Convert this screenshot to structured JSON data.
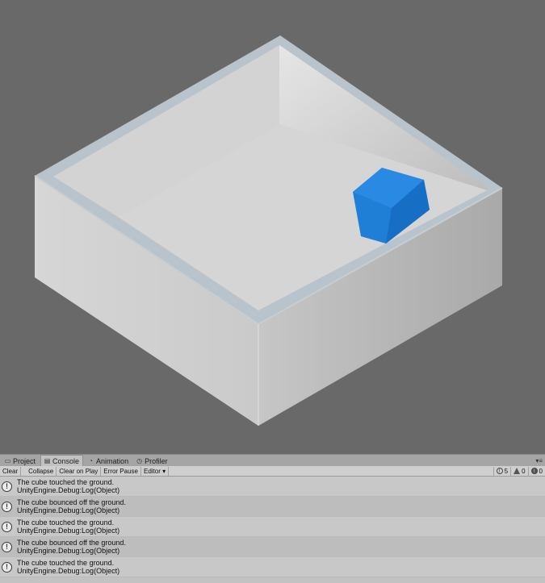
{
  "scene": {
    "background": "#696969",
    "box_color": "#c9c9c9",
    "cube_color": "#1f7fd6"
  },
  "console": {
    "tabs": [
      {
        "label": "Project",
        "icon": "folder-icon"
      },
      {
        "label": "Console",
        "icon": "console-icon"
      },
      {
        "label": "Animation",
        "icon": "animation-icon"
      },
      {
        "label": "Profiler",
        "icon": "profiler-icon"
      }
    ],
    "toolbar": {
      "clear": "Clear",
      "collapse": "Collapse",
      "clear_on_play": "Clear on Play",
      "error_pause": "Error Pause",
      "editor": "Editor ▾"
    },
    "counts": {
      "info": "5",
      "warnings": "0",
      "errors": "0"
    },
    "messages": [
      {
        "line1": "The cube touched the ground.",
        "line2": "UnityEngine.Debug:Log(Object)"
      },
      {
        "line1": "The cube bounced off the ground.",
        "line2": "UnityEngine.Debug:Log(Object)"
      },
      {
        "line1": "The cube touched the ground.",
        "line2": "UnityEngine.Debug:Log(Object)"
      },
      {
        "line1": "The cube bounced off the ground.",
        "line2": "UnityEngine.Debug:Log(Object)"
      },
      {
        "line1": "The cube touched the ground.",
        "line2": "UnityEngine.Debug:Log(Object)"
      }
    ]
  }
}
